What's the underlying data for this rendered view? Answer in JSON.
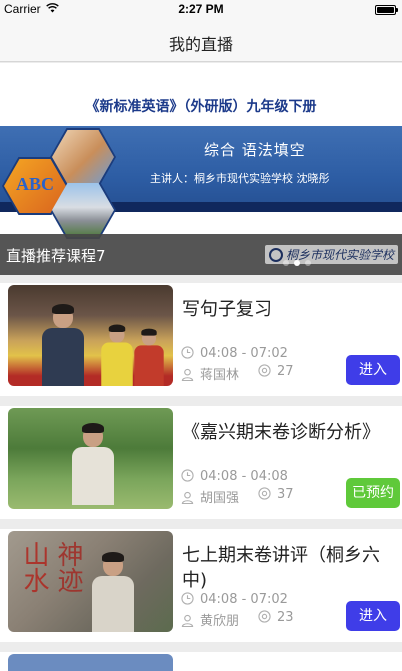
{
  "status_bar": {
    "carrier": "Carrier",
    "time": "2:27 PM"
  },
  "nav": {
    "title": "我的直播"
  },
  "banner": {
    "course_title": "《新标准英语》（外研版）九年级下册",
    "topic": "综合 语法填空",
    "lecturer": "主讲人：桐乡市现代实验学校 沈晓彤",
    "abc_text": "ABC",
    "caption": "直播推荐课程7",
    "watermark": "桐乡市现代实验学校",
    "dots_count": 3,
    "active_dot": 2
  },
  "courses": [
    {
      "title": "写句子复习",
      "time": "04:08 - 07:02",
      "host": "蒋国林",
      "views": "27",
      "button": "进入",
      "button_state": "enter"
    },
    {
      "title": "《嘉兴期末卷诊断分析》",
      "time": "04:08 - 04:08",
      "host": "胡国强",
      "views": "37",
      "button": "已预约",
      "button_state": "reserved"
    },
    {
      "title": "七上期末卷讲评（桐乡六中)",
      "time": "04:08 - 07:02",
      "host": "黄欣朋",
      "views": "23",
      "button": "进入",
      "button_state": "enter"
    }
  ],
  "colors": {
    "accent_enter": "#3f3de8",
    "accent_reserved": "#5fc93a",
    "banner_blue": "#2d5da4"
  },
  "icons": {
    "clock": "clock-icon",
    "person": "person-icon",
    "eye": "eye-icon"
  }
}
